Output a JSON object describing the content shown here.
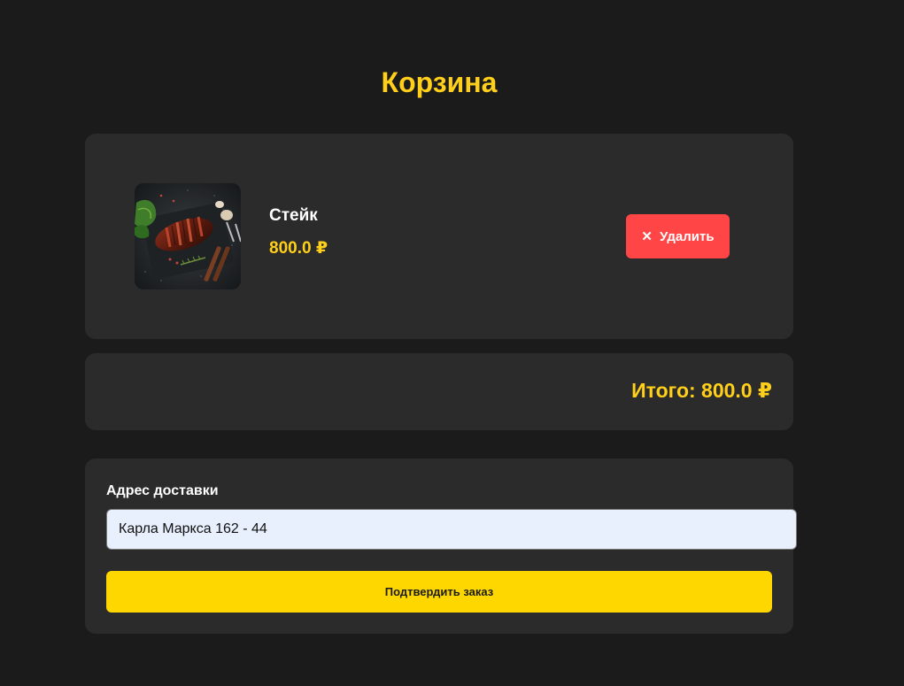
{
  "page": {
    "title": "Корзина"
  },
  "cart": {
    "items": [
      {
        "name": "Стейк",
        "price": "800.0 ₽",
        "image_icon": "steak-photo",
        "delete_label": "Удалить",
        "delete_icon": "close-icon"
      }
    ],
    "total_text": "Итого: 800.0 ₽"
  },
  "delivery": {
    "label": "Адрес доставки",
    "address_value": "Карла Маркса 162 - 44",
    "confirm_label": "Подтвердить заказ"
  },
  "colors": {
    "background": "#1b1b1b",
    "card": "#2b2b2b",
    "accent": "#ffcf1a",
    "confirm": "#ffd700",
    "danger": "#ff4545",
    "input_bg": "#e8f0fe"
  }
}
